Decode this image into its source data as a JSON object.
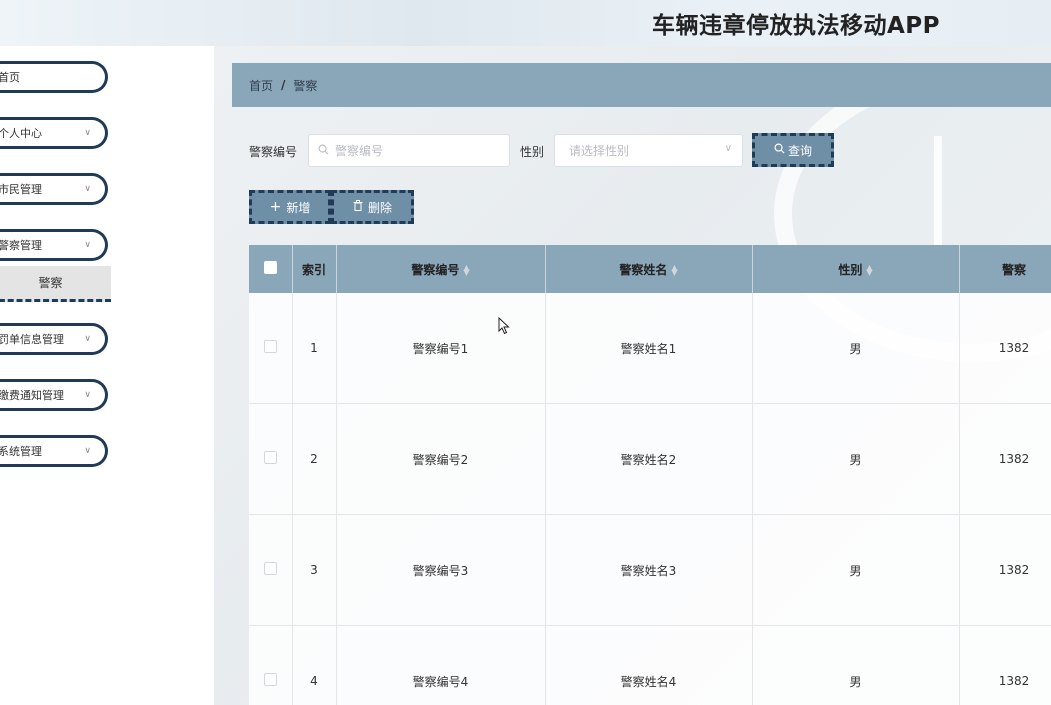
{
  "header": {
    "title": "车辆违章停放执法移动APP"
  },
  "sidebar": {
    "items": [
      {
        "label": "首页",
        "has_chevron": false
      },
      {
        "label": "个人中心",
        "has_chevron": true
      },
      {
        "label": "市民管理",
        "has_chevron": true
      },
      {
        "label": "警察管理",
        "has_chevron": true
      },
      {
        "label": "罚单信息管理",
        "has_chevron": true
      },
      {
        "label": "缴费通知管理",
        "has_chevron": true
      },
      {
        "label": "系统管理",
        "has_chevron": true
      }
    ],
    "submenu": {
      "label": "警察"
    }
  },
  "breadcrumb": {
    "home": "首页",
    "separator": "/",
    "current": "警察"
  },
  "search": {
    "code_label": "警察编号",
    "code_placeholder": "警察编号",
    "gender_label": "性别",
    "gender_placeholder": "请选择性别",
    "query_button": "查询"
  },
  "actions": {
    "add_button": "新增",
    "delete_button": "删除"
  },
  "table": {
    "headers": {
      "index": "索引",
      "code": "警察编号",
      "name": "警察姓名",
      "gender": "性别",
      "phone": "警察"
    },
    "rows": [
      {
        "index": "1",
        "code": "警察编号1",
        "name": "警察姓名1",
        "gender": "男",
        "phone": "1382"
      },
      {
        "index": "2",
        "code": "警察编号2",
        "name": "警察姓名2",
        "gender": "男",
        "phone": "1382"
      },
      {
        "index": "3",
        "code": "警察编号3",
        "name": "警察姓名3",
        "gender": "男",
        "phone": "1382"
      },
      {
        "index": "4",
        "code": "警察编号4",
        "name": "警察姓名4",
        "gender": "男",
        "phone": "1382"
      }
    ]
  },
  "colors": {
    "accent": "#8aa6b9",
    "border": "#1f3b57",
    "button": "#6f8fa6"
  },
  "icons": [
    "search-icon",
    "chevron-down-icon",
    "plus-icon",
    "trash-icon",
    "sort-icon",
    "mouse-cursor-icon"
  ]
}
